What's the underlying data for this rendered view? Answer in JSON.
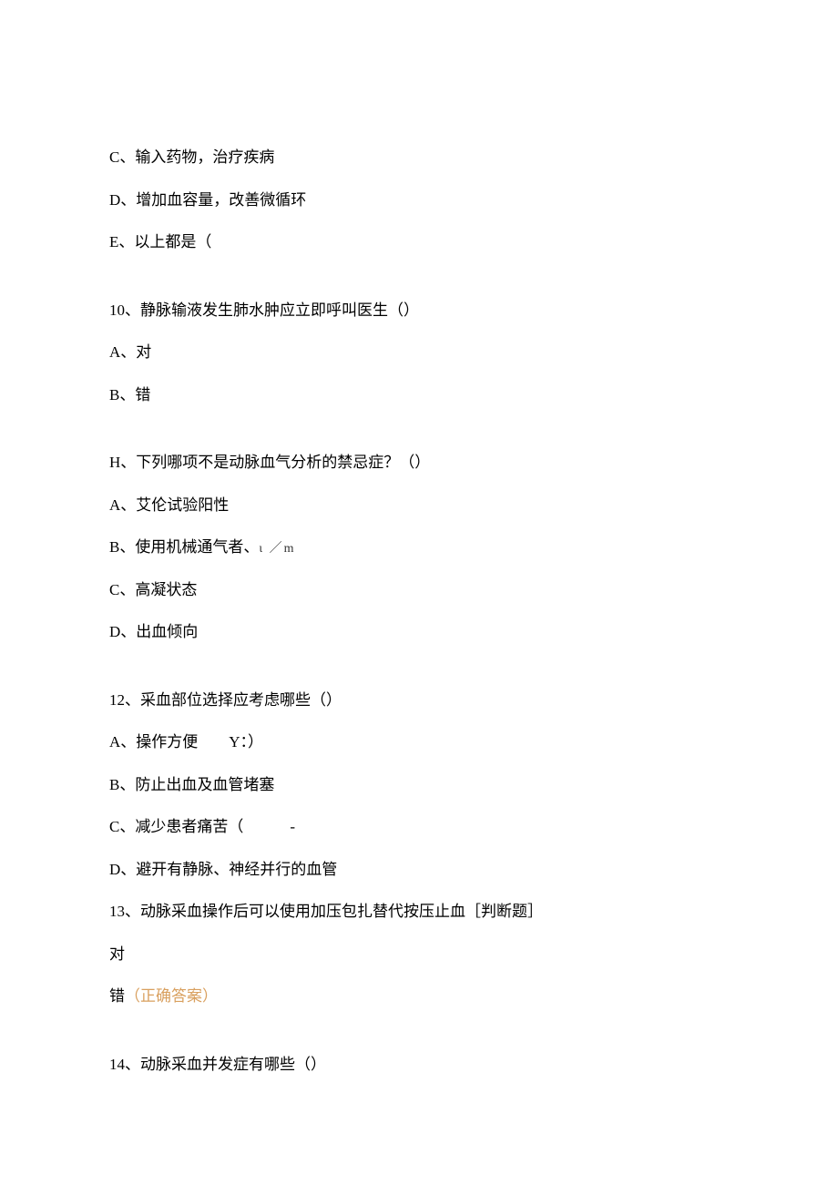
{
  "q9_partial": {
    "c": "C、输入药物，治疗疾病",
    "d": "D、增加血容量，改善微循环",
    "e": "E、以上都是（"
  },
  "q10": {
    "stem": "10、静脉输液发生肺水肿应立即呼叫医生（）",
    "a": "A、对",
    "b": "B、错"
  },
  "q11": {
    "stem": "H、下列哪项不是动脉血气分析的禁忌症？（）",
    "a": "A、艾伦试验阳性",
    "b_prefix": "B、使用机械通气者、",
    "b_sym": "ι ／m",
    "c": "C、高凝状态",
    "d": "D、出血倾向"
  },
  "q12": {
    "stem": "12、采血部位选择应考虑哪些（）",
    "a_prefix": "A、操作方便",
    "a_suffix": "        Y：）",
    "b": "B、防止出血及血管堵塞",
    "c_prefix": "C、减少患者痛苦（",
    "c_suffix": "            -",
    "d": "D、避开有静脉、神经并行的血管"
  },
  "q13": {
    "stem": "13、动脉采血操作后可以使用加压包扎替代按压止血［判断题］",
    "opt_true": "对",
    "opt_false": "错",
    "answer_label": "（正确答案）"
  },
  "q14": {
    "stem": "14、动脉采血并发症有哪些（）"
  }
}
